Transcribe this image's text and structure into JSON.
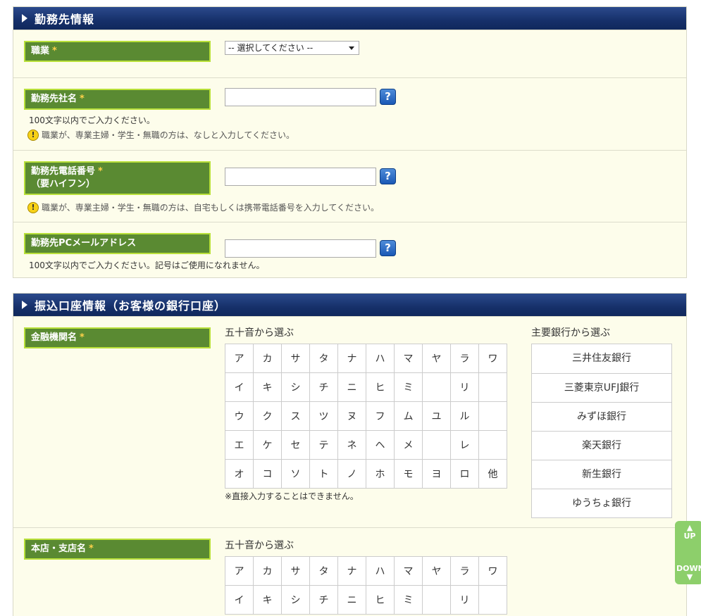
{
  "employer_section": {
    "title": "勤務先情報",
    "occupation": {
      "label": "職業",
      "required": "*",
      "select_value": "-- 選択してください --"
    },
    "company_name": {
      "label": "勤務先社名",
      "required": "*",
      "help": "?",
      "note": "100文字以内でご入力ください。",
      "warning": "職業が、専業主婦・学生・無職の方は、なしと入力してください。"
    },
    "company_phone": {
      "label": "勤務先電話番号",
      "required": "*",
      "label2": "（要ハイフン）",
      "help": "?",
      "warning": "職業が、専業主婦・学生・無職の方は、自宅もしくは携帯電話番号を入力してください。"
    },
    "company_email": {
      "label": "勤務先PCメールアドレス",
      "help": "?",
      "note": "100文字以内でご入力ください。記号はご使用になれません。"
    }
  },
  "bank_section": {
    "title": "振込口座情報（お客様の銀行口座）",
    "institution": {
      "label": "金融機関名",
      "required": "*",
      "kana_title": "五十音から選ぶ",
      "bank_title": "主要銀行から選ぶ",
      "kana_rows": [
        [
          "ア",
          "カ",
          "サ",
          "タ",
          "ナ",
          "ハ",
          "マ",
          "ヤ",
          "ラ",
          "ワ"
        ],
        [
          "イ",
          "キ",
          "シ",
          "チ",
          "ニ",
          "ヒ",
          "ミ",
          "",
          "リ",
          ""
        ],
        [
          "ウ",
          "ク",
          "ス",
          "ツ",
          "ヌ",
          "フ",
          "ム",
          "ユ",
          "ル",
          ""
        ],
        [
          "エ",
          "ケ",
          "セ",
          "テ",
          "ネ",
          "ヘ",
          "メ",
          "",
          "レ",
          ""
        ],
        [
          "オ",
          "コ",
          "ソ",
          "ト",
          "ノ",
          "ホ",
          "モ",
          "ヨ",
          "ロ",
          "他"
        ]
      ],
      "kana_note": "※直接入力することはできません。",
      "banks": [
        "三井住友銀行",
        "三菱東京UFJ銀行",
        "みずほ銀行",
        "楽天銀行",
        "新生銀行",
        "ゆうちょ銀行"
      ]
    },
    "branch": {
      "label": "本店・支店名",
      "required": "*",
      "kana_title": "五十音から選ぶ",
      "kana_rows": [
        [
          "ア",
          "カ",
          "サ",
          "タ",
          "ナ",
          "ハ",
          "マ",
          "ヤ",
          "ラ",
          "ワ"
        ],
        [
          "イ",
          "キ",
          "シ",
          "チ",
          "ニ",
          "ヒ",
          "ミ",
          "",
          "リ",
          ""
        ]
      ]
    }
  },
  "scroll": {
    "up": "UP",
    "down": "DOWN"
  }
}
